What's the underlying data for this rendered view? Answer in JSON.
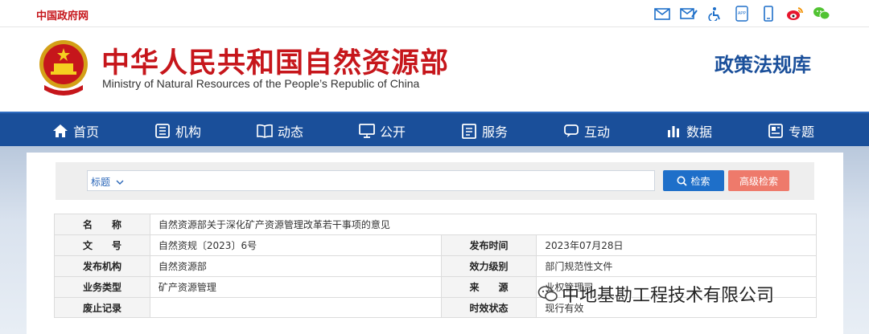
{
  "topbar": {
    "gov_link": "中国政府网",
    "icons": [
      "mail-icon",
      "mail-edit-icon",
      "accessibility-icon",
      "app-icon",
      "mobile-icon",
      "weibo-icon",
      "wechat-icon"
    ],
    "app_label": "APP"
  },
  "header": {
    "title_cn": "中华人民共和国自然资源部",
    "title_en": "Ministry of Natural Resources of the People’s Republic of China",
    "site_name": "政策法规库"
  },
  "nav": {
    "items": [
      {
        "label": "首页",
        "icon": "home-icon"
      },
      {
        "label": "机构",
        "icon": "organization-icon"
      },
      {
        "label": "动态",
        "icon": "book-icon"
      },
      {
        "label": "公开",
        "icon": "monitor-icon"
      },
      {
        "label": "服务",
        "icon": "document-icon"
      },
      {
        "label": "互动",
        "icon": "chat-icon"
      },
      {
        "label": "数据",
        "icon": "bar-chart-icon"
      },
      {
        "label": "专题",
        "icon": "topic-icon"
      }
    ]
  },
  "search": {
    "field_select": "标题",
    "placeholder": "",
    "search_button": "检索",
    "advanced_button": "高级检索"
  },
  "meta": {
    "rows": [
      {
        "k1": "名　　称",
        "v1": "自然资源部关于深化矿产资源管理改革若干事项的意见"
      },
      {
        "k1": "文　　号",
        "v1": "自然资规〔2023〕6号",
        "k2": "发布时间",
        "v2": "2023年07月28日"
      },
      {
        "k1": "发布机构",
        "v1": "自然资源部",
        "k2": "效力级别",
        "v2": "部门规范性文件"
      },
      {
        "k1": "业务类型",
        "v1": "矿产资源管理",
        "k2": "来　　源",
        "v2": "业权管理司"
      },
      {
        "k1": "废止记录",
        "v1": "",
        "k2": "时效状态",
        "v2": "现行有效"
      }
    ]
  },
  "watermark": {
    "text": "中地基勘工程技术有限公司"
  },
  "colors": {
    "brand_red": "#c6161b",
    "nav_blue": "#1a4f9a",
    "search_blue": "#1e6fc9",
    "advanced_salmon": "#ee7a6b"
  }
}
